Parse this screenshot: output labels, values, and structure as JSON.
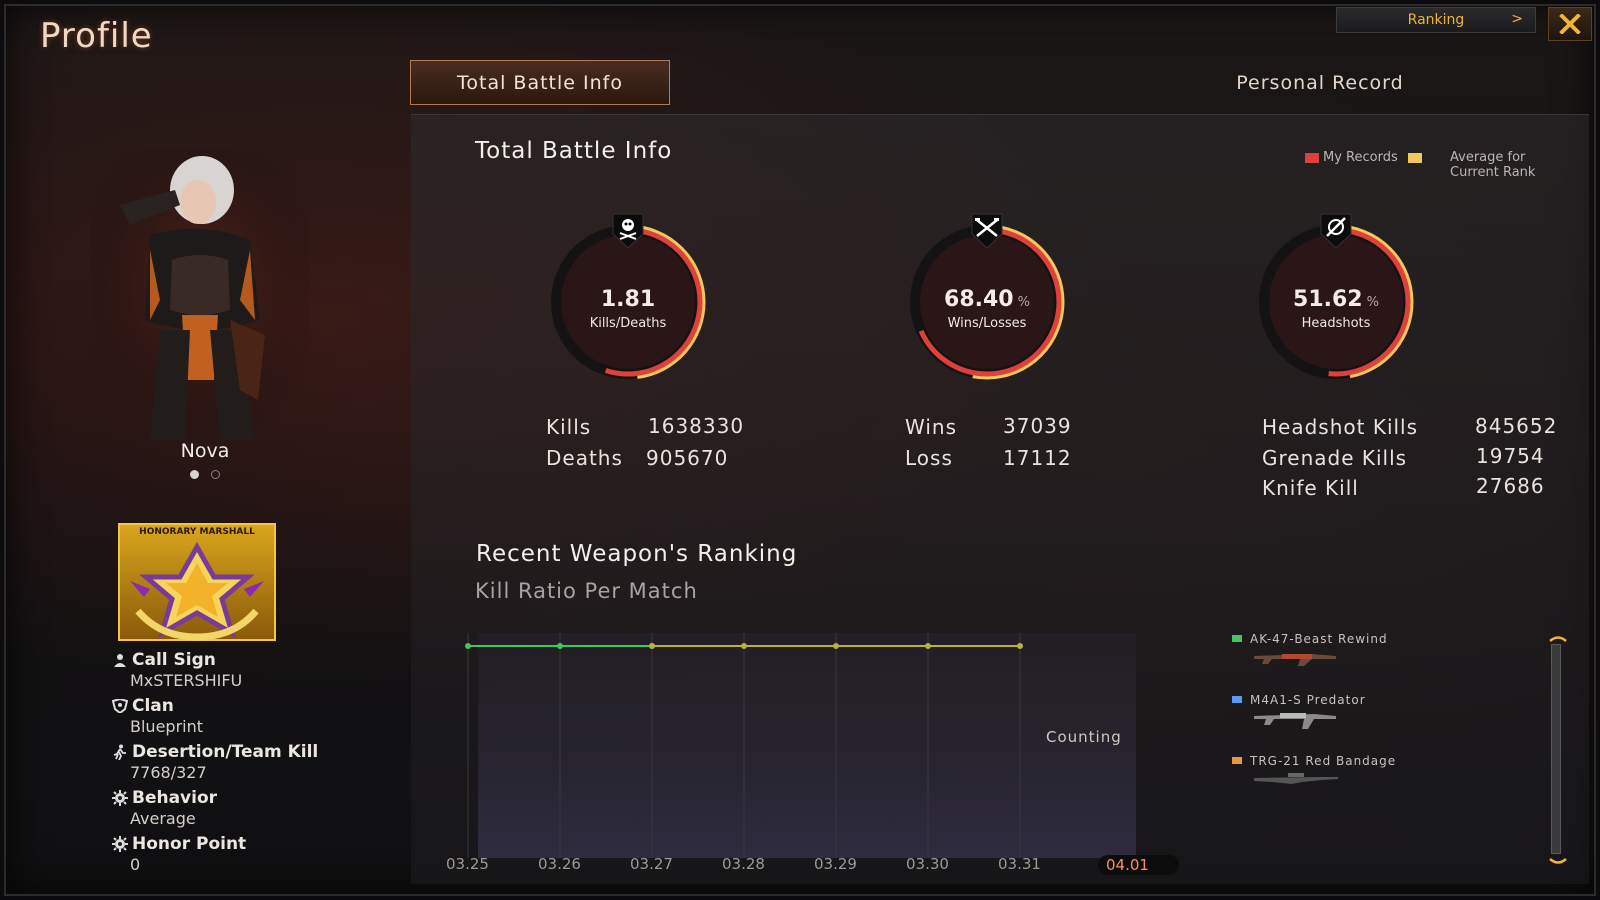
{
  "header": {
    "title": "Profile",
    "ranking_label": "Ranking",
    "ranking_chevron": ">"
  },
  "character": {
    "name": "Nova",
    "pager": {
      "count": 2,
      "active": 1
    }
  },
  "rank_badge": {
    "label": "HONORARY MARSHALL"
  },
  "player_info": {
    "call_sign_label": "Call Sign",
    "call_sign": "MxSTERSHIFU",
    "clan_label": "Clan",
    "clan": "Blueprint",
    "desertion_label": "Desertion/Team Kill",
    "desertion": "7768/327",
    "behavior_label": "Behavior",
    "behavior": "Average",
    "honor_label": "Honor Point",
    "honor": "0"
  },
  "tabs": {
    "active": "Total Battle Info",
    "inactive": "Personal Record"
  },
  "battle_info": {
    "title": "Total Battle Info",
    "legend": {
      "mine": "My Records",
      "average": "Average for Current Rank",
      "mine_color": "#e0403a",
      "average_color": "#f2c75c"
    },
    "gauges": [
      {
        "value": "1.81",
        "unit": "",
        "label": "Kills/Deaths",
        "icon": "skull-icon",
        "mine_fraction": 0.55,
        "avg_fraction": 0.48
      },
      {
        "value": "68.40",
        "unit": "%",
        "label": "Wins/Losses",
        "icon": "crossed-guns-icon",
        "mine_fraction": 0.684,
        "avg_fraction": 0.53
      },
      {
        "value": "51.62",
        "unit": "%",
        "label": "Headshots",
        "icon": "crosshair-icon",
        "mine_fraction": 0.5162,
        "avg_fraction": 0.47
      }
    ],
    "kd": {
      "kills_label": "Kills",
      "kills": "1638330",
      "deaths_label": "Deaths",
      "deaths": "905670"
    },
    "wl": {
      "wins_label": "Wins",
      "wins": "37039",
      "loss_label": "Loss",
      "loss": "17112"
    },
    "hs": {
      "headshot_label": "Headshot Kills",
      "headshot": "845652",
      "grenade_label": "Grenade Kills",
      "grenade": "19754",
      "knife_label": "Knife Kill",
      "knife": "27686"
    }
  },
  "weapon_ranking": {
    "title": "Recent Weapon's Ranking",
    "subtitle": "Kill Ratio Per Match",
    "counting_label": "Counting",
    "weapons": [
      {
        "name": "AK-47-Beast Rewind",
        "color": "#3ec75a"
      },
      {
        "name": "M4A1-S Predator",
        "color": "#5a9af0"
      },
      {
        "name": "TRG-21 Red Bandage",
        "color": "#e89a3a"
      }
    ]
  },
  "chart_data": {
    "type": "line",
    "title": "Kill Ratio Per Match",
    "categories": [
      "03.25",
      "03.26",
      "03.27",
      "03.28",
      "03.29",
      "03.30",
      "03.31",
      "04.01"
    ],
    "selected_category": "04.01",
    "series": [
      {
        "name": "AK-47-Beast Rewind",
        "color": "#3ec75a",
        "values": [
          1,
          1,
          1,
          null,
          null,
          null,
          null,
          null
        ]
      },
      {
        "name": "TRG-21 Red Bandage",
        "color": "#b8b040",
        "values": [
          null,
          null,
          1,
          1,
          1,
          1,
          1,
          null
        ]
      }
    ],
    "grid": true
  }
}
